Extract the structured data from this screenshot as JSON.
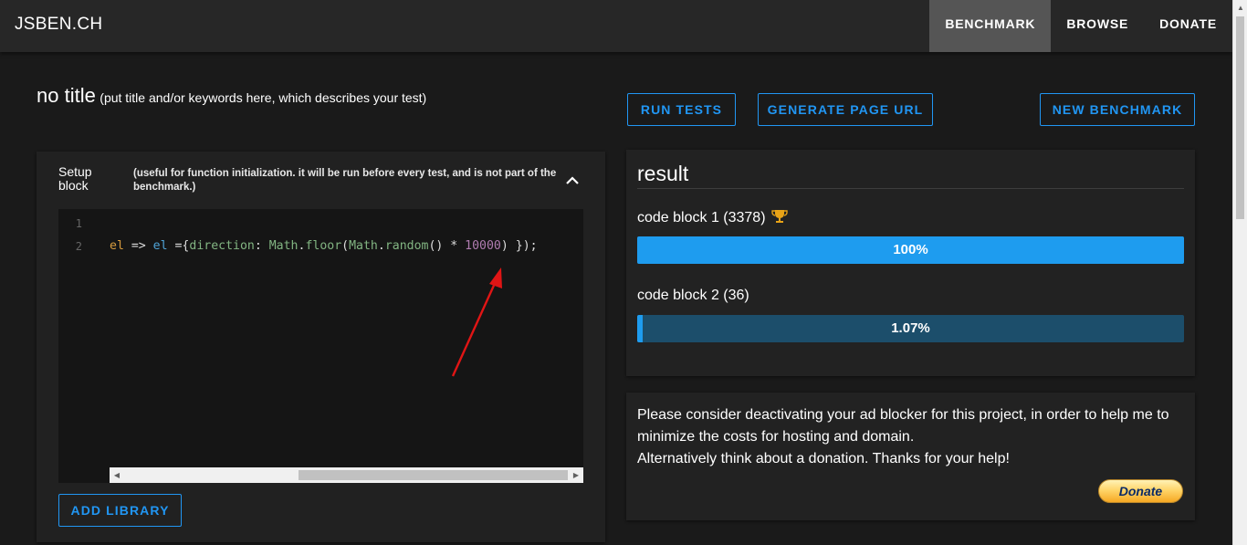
{
  "nav": {
    "brand": "JSBEN.CH",
    "items": [
      {
        "label": "BENCHMARK",
        "active": true
      },
      {
        "label": "BROWSE",
        "active": false
      },
      {
        "label": "DONATE",
        "active": false
      }
    ]
  },
  "title": {
    "main": "no title",
    "hint": "(put title and/or keywords here, which describes your test)"
  },
  "actions": {
    "run_tests": "RUN TESTS",
    "generate_url": "GENERATE PAGE URL",
    "new_benchmark": "NEW BENCHMARK"
  },
  "setup": {
    "label": "Setup block",
    "description": "(useful for function initialization. it will be run before every test, and is not part of the benchmark.)",
    "line_numbers": [
      "1",
      "2"
    ],
    "code_tokens": {
      "t1": "el",
      "t2": " => ",
      "t3": "el",
      "t4": " ={",
      "t5": "direction",
      "t6": ": ",
      "t7": "Math",
      "t8": ".",
      "t9": "floor",
      "t10": "(",
      "t11": "Math",
      "t12": ".",
      "t13": "random",
      "t14": "() * ",
      "t15": "10000",
      "t16": ") });"
    },
    "add_library": "ADD LIBRARY"
  },
  "result": {
    "title": "result",
    "blocks": [
      {
        "label": "code block 1 (3378)",
        "percent_text": "100%",
        "fill_fraction": 1.0,
        "winner": true
      },
      {
        "label": "code block 2 (36)",
        "percent_text": "1.07%",
        "fill_fraction": 0.0107,
        "winner": false
      }
    ]
  },
  "ad": {
    "text_lines": [
      "Please consider deactivating your ad blocker for this project, in order to help me to",
      "minimize the costs for hosting and domain.",
      "Alternatively think about a donation. Thanks for your help!"
    ],
    "donate_label": "Donate"
  },
  "colors": {
    "accent": "#2196f3",
    "bar_fill": "#1e9cef",
    "bar_track": "#1c4e6b",
    "annotation_arrow": "#e01515"
  },
  "icons": {
    "collapse": "chevron-up-icon",
    "winner": "trophy-icon",
    "annotation": "red-arrow-annotation"
  }
}
